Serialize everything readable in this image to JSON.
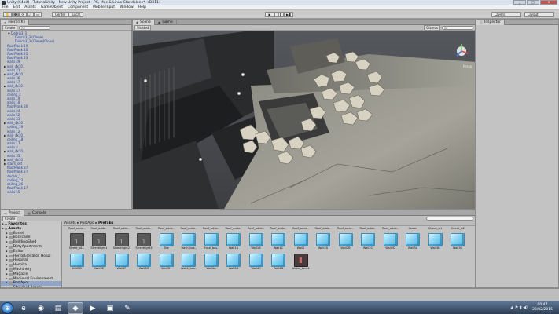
{
  "window": {
    "title": "Unity (64bit) - TutorialUnity - New Unity Project - PC, Mac & Linux Standalone* <DX11>",
    "min": "_",
    "max": "□",
    "close": "✕"
  },
  "menu": [
    "File",
    "Edit",
    "Assets",
    "GameObject",
    "Component",
    "Mobile Input",
    "Window",
    "Help"
  ],
  "toolbar": {
    "tools": [
      "✋",
      "✥",
      "⟳",
      "⤢",
      "▭"
    ],
    "center_label": "Center",
    "local_label": "Local",
    "play": "▶",
    "pause": "❚❚",
    "step": "▶❚",
    "layers_label": "Layers",
    "layout_label": "Layout"
  },
  "hierarchy": {
    "tab": "Hierarchy",
    "create_label": "Create",
    "search_placeholder": "All",
    "items": [
      {
        "text": "Debris3_3",
        "indent": 1,
        "tw": "▼"
      },
      {
        "text": "Debris3_3 (Clone)",
        "indent": 2,
        "tw": ""
      },
      {
        "text": "Debris3_3 (Clone)(Clone)",
        "indent": 2,
        "tw": ""
      },
      {
        "text": "floorPlank 19",
        "indent": 0,
        "tw": ""
      },
      {
        "text": "floorPlank 20",
        "indent": 0,
        "tw": ""
      },
      {
        "text": "floorPlank 21",
        "indent": 0,
        "tw": ""
      },
      {
        "text": "floorPlank 23",
        "indent": 0,
        "tw": ""
      },
      {
        "text": "walls 49",
        "indent": 0,
        "tw": ""
      },
      {
        "text": "wall_4x10",
        "indent": 0,
        "tw": "▶"
      },
      {
        "text": "walls 21",
        "indent": 0,
        "tw": ""
      },
      {
        "text": "wall_4x10",
        "indent": 0,
        "tw": "▶"
      },
      {
        "text": "walls 36",
        "indent": 0,
        "tw": ""
      },
      {
        "text": "walls 17",
        "indent": 0,
        "tw": ""
      },
      {
        "text": "wall_4x10",
        "indent": 0,
        "tw": "▶"
      },
      {
        "text": "walls 47",
        "indent": 0,
        "tw": ""
      },
      {
        "text": "ceiling_2",
        "indent": 0,
        "tw": ""
      },
      {
        "text": "walls 19",
        "indent": 0,
        "tw": ""
      },
      {
        "text": "walls 18",
        "indent": 0,
        "tw": ""
      },
      {
        "text": "floorPlank 30",
        "indent": 0,
        "tw": ""
      },
      {
        "text": "walls 24",
        "indent": 0,
        "tw": ""
      },
      {
        "text": "walls 52",
        "indent": 0,
        "tw": ""
      },
      {
        "text": "walls 33",
        "indent": 0,
        "tw": ""
      },
      {
        "text": "wall_4x10",
        "indent": 0,
        "tw": "▶"
      },
      {
        "text": "ceiling_19",
        "indent": 0,
        "tw": ""
      },
      {
        "text": "walls 12",
        "indent": 0,
        "tw": ""
      },
      {
        "text": "wall_4x10",
        "indent": 0,
        "tw": "▶"
      },
      {
        "text": "ceiling_18",
        "indent": 0,
        "tw": ""
      },
      {
        "text": "walls 17",
        "indent": 0,
        "tw": ""
      },
      {
        "text": "walls 4",
        "indent": 0,
        "tw": ""
      },
      {
        "text": "wall_4x10",
        "indent": 0,
        "tw": "▶"
      },
      {
        "text": "walls 35",
        "indent": 0,
        "tw": ""
      },
      {
        "text": "wall_4x10",
        "indent": 0,
        "tw": "▶"
      },
      {
        "text": "stairs_set",
        "indent": 0,
        "tw": "▶"
      },
      {
        "text": "floorPlank 37",
        "indent": 0,
        "tw": ""
      },
      {
        "text": "floorPlank 27",
        "indent": 0,
        "tw": ""
      },
      {
        "text": "decals_1",
        "indent": 0,
        "tw": ""
      },
      {
        "text": "ceiling_23",
        "indent": 0,
        "tw": ""
      },
      {
        "text": "ceiling_26",
        "indent": 0,
        "tw": ""
      },
      {
        "text": "floorPlank 17",
        "indent": 0,
        "tw": ""
      },
      {
        "text": "walls 15",
        "indent": 0,
        "tw": ""
      }
    ]
  },
  "scene": {
    "tab_scene": "Scene",
    "tab_game": "Game",
    "shaded_label": "Shaded",
    "gizmos_label": "Gizmos",
    "search_placeholder": "All",
    "persp_label": "Persp"
  },
  "inspector": {
    "tab": "Inspector"
  },
  "project": {
    "tab_project": "Project",
    "tab_console": "Console",
    "create_label": "Create",
    "breadcrumb": [
      "Assets",
      "PostApo",
      "Prefabs"
    ],
    "tree": [
      {
        "text": "Favorites",
        "level": 0,
        "fav": true
      },
      {
        "text": "Assets",
        "level": 0,
        "fav": true
      },
      {
        "text": "Barrel",
        "level": 1
      },
      {
        "text": "Barricade",
        "level": 1
      },
      {
        "text": "BuildingShed",
        "level": 1
      },
      {
        "text": "DirtyApartments",
        "level": 1
      },
      {
        "text": "Editor",
        "level": 1
      },
      {
        "text": "HorrorElevator_Hospi",
        "level": 1
      },
      {
        "text": "Hospital",
        "level": 1
      },
      {
        "text": "Hospita",
        "level": 1
      },
      {
        "text": "Machinery",
        "level": 1
      },
      {
        "text": "Magazin",
        "level": 1
      },
      {
        "text": "Medieval Environment",
        "level": 1
      },
      {
        "text": "PostApo",
        "level": 1,
        "sel": true
      },
      {
        "text": "Standard Assets",
        "level": 1
      }
    ],
    "assets_row1_labels": [
      "Roof_adde..",
      "Roof_adde..",
      "Roof_adde..",
      "Roof_adde..",
      "Roof_adde..",
      "Roof_adde..",
      "Roof_adde..",
      "Roof_adde..",
      "Roof_adde..",
      "Roof_adde..",
      "Roof_adde..",
      "Roof_adde..",
      "Roof_adde..",
      "Roof_adde..",
      "Roof_adde..",
      "Sewer",
      "Street_A1",
      "Street_A2"
    ],
    "assets": [
      {
        "label": "Street_a1..",
        "kind": "dark"
      },
      {
        "label": "Streetlight1",
        "kind": "dark"
      },
      {
        "label": "Streetlight2",
        "kind": "dark"
      },
      {
        "label": "Streetlight3",
        "kind": "dark"
      },
      {
        "label": "Tire",
        "kind": "cube"
      },
      {
        "label": "Trash_bas..",
        "kind": "cube"
      },
      {
        "label": "Trash_bas..",
        "kind": "cube"
      },
      {
        "label": "Wall1A",
        "kind": "cube"
      },
      {
        "label": "Wall1B",
        "kind": "cube"
      },
      {
        "label": "Wall1C",
        "kind": "cube"
      },
      {
        "label": "Wall2",
        "kind": "cube"
      },
      {
        "label": "Wall2A",
        "kind": "cube"
      },
      {
        "label": "Wall2B",
        "kind": "cube"
      },
      {
        "label": "Wall2C",
        "kind": "cube"
      },
      {
        "label": "Wall2D",
        "kind": "cube"
      },
      {
        "label": "Wall3A",
        "kind": "cube"
      },
      {
        "label": "Wall3B",
        "kind": "cube"
      },
      {
        "label": "Wall3C",
        "kind": "cube"
      },
      {
        "label": "Wall3D",
        "kind": "cube"
      },
      {
        "label": "Wall3E",
        "kind": "cube"
      },
      {
        "label": "Wall3F",
        "kind": "cube"
      },
      {
        "label": "Wall3G",
        "kind": "cube"
      },
      {
        "label": "Wall3H",
        "kind": "cube"
      },
      {
        "label": "Wall4_bas..",
        "kind": "cube"
      },
      {
        "label": "Wall4A",
        "kind": "cube"
      },
      {
        "label": "Wall4B",
        "kind": "cube"
      },
      {
        "label": "Wall4C",
        "kind": "cube"
      },
      {
        "label": "Wall4D",
        "kind": "cube"
      },
      {
        "label": "Water_tank1",
        "kind": "darkred"
      }
    ]
  },
  "taskbar": {
    "time": "00:47",
    "date": "23/02/2015",
    "apps": [
      "e",
      "◉",
      "▤",
      "◆",
      "▶",
      "▣",
      "✎"
    ]
  }
}
